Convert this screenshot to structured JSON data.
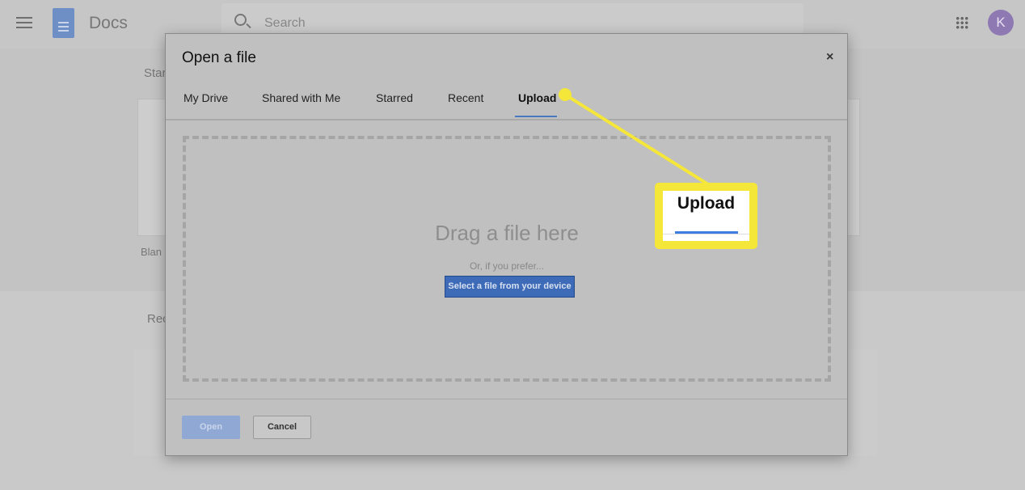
{
  "app": {
    "name": "Docs",
    "search_placeholder": "Search",
    "avatar_initial": "K"
  },
  "background": {
    "starred_heading_partial": "Star",
    "blank_label_partial": "Blan",
    "recent_heading_partial": "Rec"
  },
  "dialog": {
    "title": "Open a file",
    "close": "×",
    "tabs": [
      {
        "label": "My Drive"
      },
      {
        "label": "Shared with Me"
      },
      {
        "label": "Starred"
      },
      {
        "label": "Recent"
      },
      {
        "label": "Upload",
        "active": true
      }
    ],
    "drop_text": "Drag a file here",
    "prefer_text": "Or, if you prefer...",
    "select_button": "Select a file from your device",
    "open_button": "Open",
    "cancel_button": "Cancel"
  },
  "callout": {
    "label": "Upload",
    "color": "#f5e63a"
  },
  "colors": {
    "accent": "#4a78c2"
  }
}
